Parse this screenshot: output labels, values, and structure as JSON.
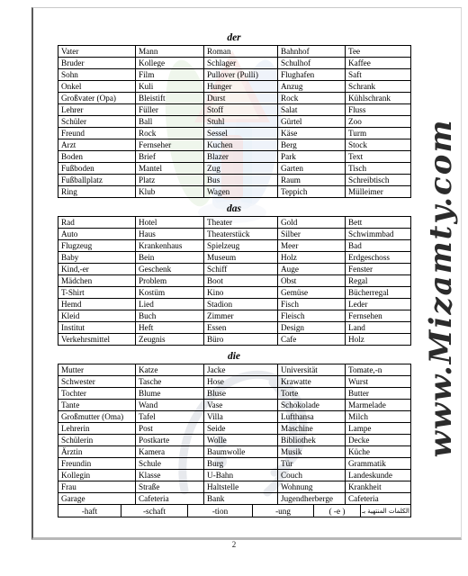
{
  "document": {
    "page_number": "2",
    "watermark": {
      "site_text": "www.Mizamty.com",
      "logo_name": "colored-book-logo-watermark",
      "swirl_name": "arabic-calligraphy-swirl-watermark"
    }
  },
  "sections": [
    {
      "id": "der",
      "title": "der",
      "columns": 5,
      "rows": [
        [
          "Vater",
          "Mann",
          "Roman",
          "Bahnhof",
          "Tee"
        ],
        [
          "Bruder",
          "Kollege",
          "Schlager",
          "Schulhof",
          "Kaffee"
        ],
        [
          "Sohn",
          "Film",
          "Pullover (Pulli)",
          "Flughafen",
          "Saft"
        ],
        [
          "Onkel",
          "Kuli",
          "Hunger",
          "Anzug",
          "Schrank"
        ],
        [
          "Großvater (Opa)",
          "Bleistift",
          "Durst",
          "Rock",
          "Kühlschrank"
        ],
        [
          "Lehrer",
          "Füller",
          "Stoff",
          "Salat",
          "Fluss"
        ],
        [
          "Schüler",
          "Ball",
          "Stuhl",
          "Gürtel",
          "Zoo"
        ],
        [
          "Freund",
          "Rock",
          "Sessel",
          "Käse",
          "Turm"
        ],
        [
          "Arzt",
          "Fernseher",
          "Kuchen",
          "Berg",
          "Stock"
        ],
        [
          "Boden",
          "Brief",
          "Blazer",
          "Park",
          "Text"
        ],
        [
          "Fußboden",
          "Mantel",
          "Zug",
          "Garten",
          "Tisch"
        ],
        [
          "Fußballplatz",
          "Platz",
          "Bus",
          "Raum",
          "Schreibtisch"
        ],
        [
          "Ring",
          "Klub",
          "Wagen",
          "Teppich",
          "Mülleimer"
        ]
      ]
    },
    {
      "id": "das",
      "title": "das",
      "columns": 5,
      "rows": [
        [
          "Rad",
          "Hotel",
          "Theater",
          "Gold",
          "Bett"
        ],
        [
          "Auto",
          "Haus",
          "Theaterstück",
          "Silber",
          "Schwimmbad"
        ],
        [
          "Flugzeug",
          "Krankenhaus",
          "Spielzeug",
          "Meer",
          "Bad"
        ],
        [
          "Baby",
          "Bein",
          "Museum",
          "Holz",
          "Erdgeschoss"
        ],
        [
          "Kind,-er",
          "Geschenk",
          "Schiff",
          "Auge",
          "Fenster"
        ],
        [
          "Mädchen",
          "Problem",
          "Boot",
          "Obst",
          "Regal"
        ],
        [
          "T-Shirt",
          "Kostüm",
          "Kino",
          "Gemüse",
          "Bücherregal"
        ],
        [
          "Hemd",
          "Lied",
          "Stadion",
          "Fisch",
          "Leder"
        ],
        [
          "Kleid",
          "Buch",
          "Zimmer",
          "Fleisch",
          "Fernsehen"
        ],
        [
          "Institut",
          "Heft",
          "Essen",
          "Design",
          "Land"
        ],
        [
          "Verkehrsmittel",
          "Zeugnis",
          "Büro",
          "Cafe",
          "Holz"
        ]
      ]
    },
    {
      "id": "die",
      "title": "die",
      "columns": 5,
      "rows": [
        [
          "Mutter",
          "Katze",
          "Jacke",
          "Universität",
          "Tomate,-n"
        ],
        [
          "Schwester",
          "Tasche",
          "Hose",
          "Krawatte",
          "Wurst"
        ],
        [
          "Tochter",
          "Blume",
          "Bluse",
          "Torte",
          "Butter"
        ],
        [
          "Tante",
          "Wand",
          "Vase",
          "Schokolade",
          "Marmelade"
        ],
        [
          "Großmutter (Oma)",
          "Tafel",
          "Villa",
          "Lufthansa",
          "Milch"
        ],
        [
          "Lehrerin",
          "Post",
          "Seide",
          "Maschine",
          "Lampe"
        ],
        [
          "Schülerin",
          "Postkarte",
          "Wolle",
          "Bibliothek",
          "Decke"
        ],
        [
          "Ärztin",
          "Kamera",
          "Baumwolle",
          "Musik",
          "Küche"
        ],
        [
          "Freundin",
          "Schule",
          "Burg",
          "Tür",
          "Grammatik"
        ],
        [
          "Kollegin",
          "Klasse",
          "U-Bahn",
          "Couch",
          "Landeskunde"
        ],
        [
          "Frau",
          "Straße",
          "Haltstelle",
          "Wohnung",
          "Krankheit"
        ],
        [
          "Garage",
          "Cafeteria",
          "Bank",
          "Jugendherberge",
          "Cafeteria"
        ]
      ],
      "suffix_row": [
        "-haft",
        "-schaft",
        "-tion",
        "-ung",
        "( -e )",
        "الكلمات المنتهية بـ :"
      ]
    }
  ]
}
